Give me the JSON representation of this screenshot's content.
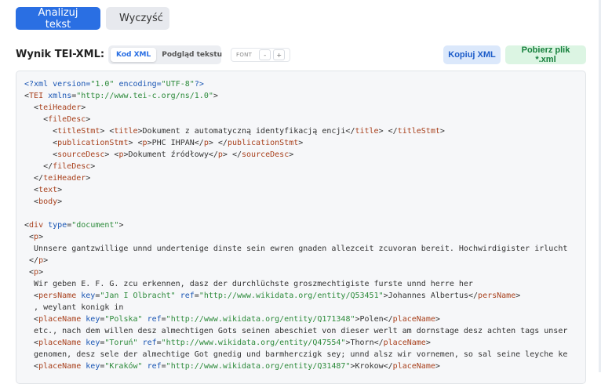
{
  "toolbar": {
    "analyze_label": "Analizuj tekst",
    "clear_label": "Wyczyść"
  },
  "result": {
    "title": "Wynik TEI-XML:",
    "tabs": [
      {
        "label": "Kod XML",
        "active": true
      },
      {
        "label": "Podgląd tekstu",
        "active": false
      }
    ],
    "font_label": "FONT",
    "font_decrease": "-",
    "font_increase": "+",
    "copy_label": "Kopiuj XML",
    "download_label": "Pobierz plik *.xml"
  },
  "colors": {
    "primary": "#2a6fe3",
    "xml_tag": "#a8401c",
    "xml_attr": "#1a56b4",
    "xml_value": "#2c8a3a"
  },
  "code_lines": [
    [
      [
        "pi",
        "<?xml "
      ],
      [
        "attr",
        "version"
      ],
      [
        "pi",
        "="
      ],
      [
        "val",
        "\"1.0\""
      ],
      [
        "pi",
        " "
      ],
      [
        "attr",
        "encoding"
      ],
      [
        "pi",
        "="
      ],
      [
        "val",
        "\"UTF-8\""
      ],
      [
        "pi",
        "?>"
      ]
    ],
    [
      [
        "txt",
        "<"
      ],
      [
        "tag",
        "TEI"
      ],
      [
        "txt",
        " "
      ],
      [
        "attr",
        "xmlns"
      ],
      [
        "txt",
        "="
      ],
      [
        "val",
        "\"http://www.tei-c.org/ns/1.0\""
      ],
      [
        "txt",
        ">"
      ]
    ],
    [
      [
        "txt",
        "  <"
      ],
      [
        "tag",
        "teiHeader"
      ],
      [
        "txt",
        ">"
      ]
    ],
    [
      [
        "txt",
        "    <"
      ],
      [
        "tag",
        "fileDesc"
      ],
      [
        "txt",
        ">"
      ]
    ],
    [
      [
        "txt",
        "      <"
      ],
      [
        "tag",
        "titleStmt"
      ],
      [
        "txt",
        "> <"
      ],
      [
        "tag",
        "title"
      ],
      [
        "txt",
        ">Dokument z automatyczną identyfikacją encji</"
      ],
      [
        "tag",
        "title"
      ],
      [
        "txt",
        "> </"
      ],
      [
        "tag",
        "titleStmt"
      ],
      [
        "txt",
        ">"
      ]
    ],
    [
      [
        "txt",
        "      <"
      ],
      [
        "tag",
        "publicationStmt"
      ],
      [
        "txt",
        "> <"
      ],
      [
        "tag",
        "p"
      ],
      [
        "txt",
        ">PHC IHPAN</"
      ],
      [
        "tag",
        "p"
      ],
      [
        "txt",
        "> </"
      ],
      [
        "tag",
        "publicationStmt"
      ],
      [
        "txt",
        ">"
      ]
    ],
    [
      [
        "txt",
        "      <"
      ],
      [
        "tag",
        "sourceDesc"
      ],
      [
        "txt",
        "> <"
      ],
      [
        "tag",
        "p"
      ],
      [
        "txt",
        ">Dokument źródłowy</"
      ],
      [
        "tag",
        "p"
      ],
      [
        "txt",
        "> </"
      ],
      [
        "tag",
        "sourceDesc"
      ],
      [
        "txt",
        ">"
      ]
    ],
    [
      [
        "txt",
        "    </"
      ],
      [
        "tag",
        "fileDesc"
      ],
      [
        "txt",
        ">"
      ]
    ],
    [
      [
        "txt",
        "  </"
      ],
      [
        "tag",
        "teiHeader"
      ],
      [
        "txt",
        ">"
      ]
    ],
    [
      [
        "txt",
        "  <"
      ],
      [
        "tag",
        "text"
      ],
      [
        "txt",
        ">"
      ]
    ],
    [
      [
        "txt",
        "  <"
      ],
      [
        "tag",
        "body"
      ],
      [
        "txt",
        ">"
      ]
    ],
    [],
    [
      [
        "txt",
        "<"
      ],
      [
        "tag",
        "div"
      ],
      [
        "txt",
        " "
      ],
      [
        "attr",
        "type"
      ],
      [
        "txt",
        "="
      ],
      [
        "val",
        "\"document\""
      ],
      [
        "txt",
        ">"
      ]
    ],
    [
      [
        "txt",
        " <"
      ],
      [
        "tag",
        "p"
      ],
      [
        "txt",
        ">"
      ]
    ],
    [
      [
        "txt",
        "  Unnsere gantzwillige unnd undertenige dinste sein ewren gnaden allezceit zcuvoran bereit. Hochwirdigister irlucht"
      ]
    ],
    [
      [
        "txt",
        " </"
      ],
      [
        "tag",
        "p"
      ],
      [
        "txt",
        ">"
      ]
    ],
    [
      [
        "txt",
        " <"
      ],
      [
        "tag",
        "p"
      ],
      [
        "txt",
        ">"
      ]
    ],
    [
      [
        "txt",
        "  Wir geben E. F. G. zcu erkennen, dasz der durchlüchste groszmechtigiste furste unnd herre her"
      ]
    ],
    [
      [
        "txt",
        "  <"
      ],
      [
        "tag",
        "persName"
      ],
      [
        "txt",
        " "
      ],
      [
        "attr",
        "key"
      ],
      [
        "txt",
        "="
      ],
      [
        "val",
        "\"Jan I Olbracht\""
      ],
      [
        "txt",
        " "
      ],
      [
        "attr",
        "ref"
      ],
      [
        "txt",
        "="
      ],
      [
        "val",
        "\"http://www.wikidata.org/entity/Q53451\""
      ],
      [
        "txt",
        ">Johannes Albertus</"
      ],
      [
        "tag",
        "persName"
      ],
      [
        "txt",
        ">"
      ]
    ],
    [
      [
        "txt",
        "  , weylant konigk in"
      ]
    ],
    [
      [
        "txt",
        "  <"
      ],
      [
        "tag",
        "placeName"
      ],
      [
        "txt",
        " "
      ],
      [
        "attr",
        "key"
      ],
      [
        "txt",
        "="
      ],
      [
        "val",
        "\"Polska\""
      ],
      [
        "txt",
        " "
      ],
      [
        "attr",
        "ref"
      ],
      [
        "txt",
        "="
      ],
      [
        "val",
        "\"http://www.wikidata.org/entity/Q171348\""
      ],
      [
        "txt",
        ">Polen</"
      ],
      [
        "tag",
        "placeName"
      ],
      [
        "txt",
        ">"
      ]
    ],
    [
      [
        "txt",
        "  etc., nach dem willen desz almechtigen Gots seinen abeschiet von dieser werlt am dornstage desz achten tags unser"
      ]
    ],
    [
      [
        "txt",
        "  <"
      ],
      [
        "tag",
        "placeName"
      ],
      [
        "txt",
        " "
      ],
      [
        "attr",
        "key"
      ],
      [
        "txt",
        "="
      ],
      [
        "val",
        "\"Toruń\""
      ],
      [
        "txt",
        " "
      ],
      [
        "attr",
        "ref"
      ],
      [
        "txt",
        "="
      ],
      [
        "val",
        "\"http://www.wikidata.org/entity/Q47554\""
      ],
      [
        "txt",
        ">Thorn</"
      ],
      [
        "tag",
        "placeName"
      ],
      [
        "txt",
        ">"
      ]
    ],
    [
      [
        "txt",
        "  genomen, desz sele der almechtige Got gnedig und barmherczigk sey; unnd alsz wir vornemen, so sal seine leyche ke"
      ]
    ],
    [
      [
        "txt",
        "  <"
      ],
      [
        "tag",
        "placeName"
      ],
      [
        "txt",
        " "
      ],
      [
        "attr",
        "key"
      ],
      [
        "txt",
        "="
      ],
      [
        "val",
        "\"Kraków\""
      ],
      [
        "txt",
        " "
      ],
      [
        "attr",
        "ref"
      ],
      [
        "txt",
        "="
      ],
      [
        "val",
        "\"http://www.wikidata.org/entity/Q31487\""
      ],
      [
        "txt",
        ">Krokow</"
      ],
      [
        "tag",
        "placeName"
      ],
      [
        "txt",
        ">"
      ]
    ]
  ]
}
